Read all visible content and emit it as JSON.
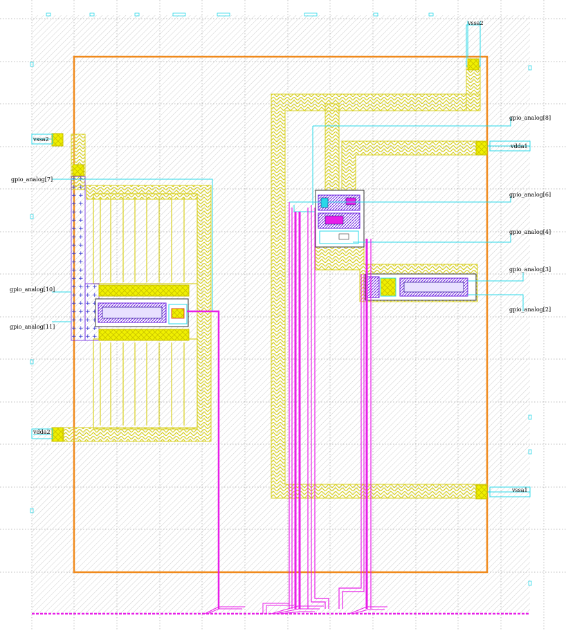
{
  "colors": {
    "background": "#ffffff",
    "grid": "#b8b8b8",
    "boundary": "#f08a1c",
    "metal_yellow": "#d8d020",
    "pad_yellow": "#f0f000",
    "metal_cyan": "#2ad8e8",
    "metal_magenta": "#e81ee8",
    "purple": "#6a1ee0",
    "hatch": "#d0d0d0"
  },
  "pins": [
    {
      "id": "vssa2_top",
      "label": "vssa2"
    },
    {
      "id": "vssa2_left",
      "label": "vssa2"
    },
    {
      "id": "gpio_analog_7",
      "label": "gpio_analog[7]"
    },
    {
      "id": "gpio_analog_10",
      "label": "gpio_analog[10]"
    },
    {
      "id": "gpio_analog_11",
      "label": "gpio_analog[11]"
    },
    {
      "id": "vdda2",
      "label": "vdda2"
    },
    {
      "id": "gpio_analog_8",
      "label": "gpio_analog[8]"
    },
    {
      "id": "vdda1",
      "label": "vdda1"
    },
    {
      "id": "gpio_analog_6",
      "label": "gpio_analog[6]"
    },
    {
      "id": "gpio_analog_4",
      "label": "gpio_analog[4]"
    },
    {
      "id": "gpio_analog_3",
      "label": "gpio_analog[3]"
    },
    {
      "id": "gpio_analog_2",
      "label": "gpio_analog[2]"
    },
    {
      "id": "vssa1",
      "label": "vssa1"
    }
  ]
}
